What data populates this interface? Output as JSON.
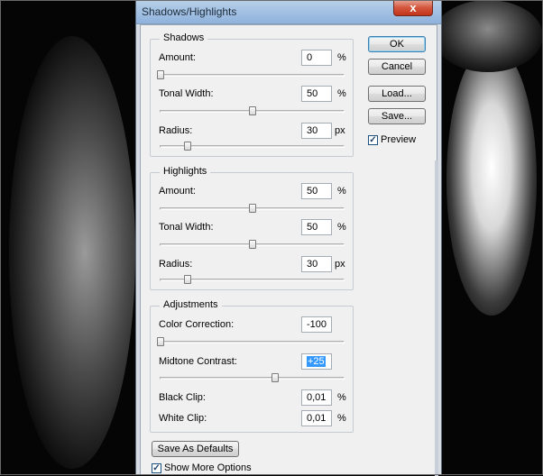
{
  "window": {
    "title": "Shadows/Highlights",
    "close_glyph": "x"
  },
  "shadows": {
    "title": "Shadows",
    "amount": {
      "label": "Amount:",
      "value": "0",
      "unit": "%",
      "slider_fraction": 0.0
    },
    "tonal_width": {
      "label": "Tonal Width:",
      "value": "50",
      "unit": "%",
      "slider_fraction": 0.5
    },
    "radius": {
      "label": "Radius:",
      "value": "30",
      "unit": "px",
      "slider_fraction": 0.15
    }
  },
  "highlights": {
    "title": "Highlights",
    "amount": {
      "label": "Amount:",
      "value": "50",
      "unit": "%",
      "slider_fraction": 0.5
    },
    "tonal_width": {
      "label": "Tonal Width:",
      "value": "50",
      "unit": "%",
      "slider_fraction": 0.5
    },
    "radius": {
      "label": "Radius:",
      "value": "30",
      "unit": "px",
      "slider_fraction": 0.15
    }
  },
  "adjustments": {
    "title": "Adjustments",
    "color_correction": {
      "label": "Color Correction:",
      "value": "-100",
      "slider_fraction": 0.0
    },
    "midtone_contrast": {
      "label": "Midtone Contrast:",
      "value": "+25",
      "slider_fraction": 0.625
    },
    "black_clip": {
      "label": "Black Clip:",
      "value": "0,01",
      "unit": "%"
    },
    "white_clip": {
      "label": "White Clip:",
      "value": "0,01",
      "unit": "%"
    }
  },
  "buttons": {
    "ok": "OK",
    "cancel": "Cancel",
    "load": "Load...",
    "save": "Save...",
    "save_defaults": "Save As Defaults"
  },
  "preview": {
    "label": "Preview",
    "checked": true
  },
  "show_more_options": {
    "label": "Show More Options",
    "checked": true
  },
  "check_glyph": "✓",
  "colors": {
    "title_bar": "#a5c2e3",
    "close_button": "#c2331a",
    "selection": "#3399ff",
    "dialog_bg": "#f0f0f0"
  }
}
